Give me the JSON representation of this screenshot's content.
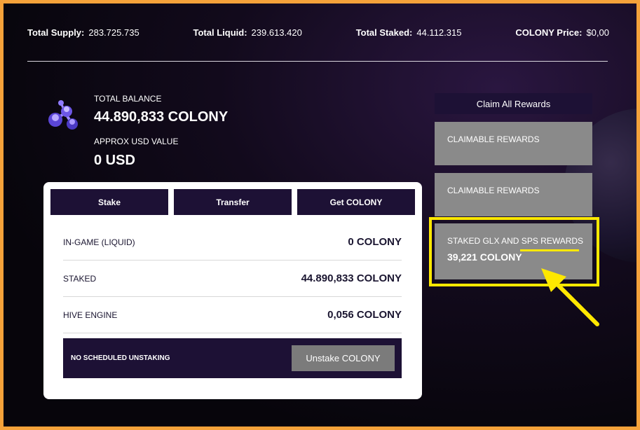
{
  "stats": [
    {
      "label": "Total Supply:",
      "value": "283.725.735"
    },
    {
      "label": "Total Liquid:",
      "value": "239.613.420"
    },
    {
      "label": "Total Staked:",
      "value": "44.112.315"
    },
    {
      "label": "COLONY Price:",
      "value": "$0,00"
    }
  ],
  "balance": {
    "total_label": "TOTAL BALANCE",
    "total_value": "44.890,833 COLONY",
    "usd_label": "APPROX USD VALUE",
    "usd_value": "0 USD"
  },
  "tabs": [
    {
      "label": "Stake"
    },
    {
      "label": "Transfer"
    },
    {
      "label": "Get COLONY"
    }
  ],
  "rows": [
    {
      "label": "IN-GAME (LIQUID)",
      "value": "0 COLONY"
    },
    {
      "label": "STAKED",
      "value": "44.890,833 COLONY"
    },
    {
      "label": "HIVE ENGINE",
      "value": "0,056 COLONY"
    }
  ],
  "unstake": {
    "note": "NO SCHEDULED UNSTAKING",
    "button": "Unstake COLONY"
  },
  "rewards": {
    "claim_all": "Claim All Rewards",
    "box1_label": "CLAIMABLE REWARDS",
    "box2_label": "CLAIMABLE REWARDS",
    "box3_label": "STAKED GLX AND SPS REWARDS",
    "box3_amount": "39,221 COLONY"
  },
  "colors": {
    "frame_border": "#f5a23a",
    "panel_dark": "#1d1135",
    "highlight": "#ffe800"
  }
}
